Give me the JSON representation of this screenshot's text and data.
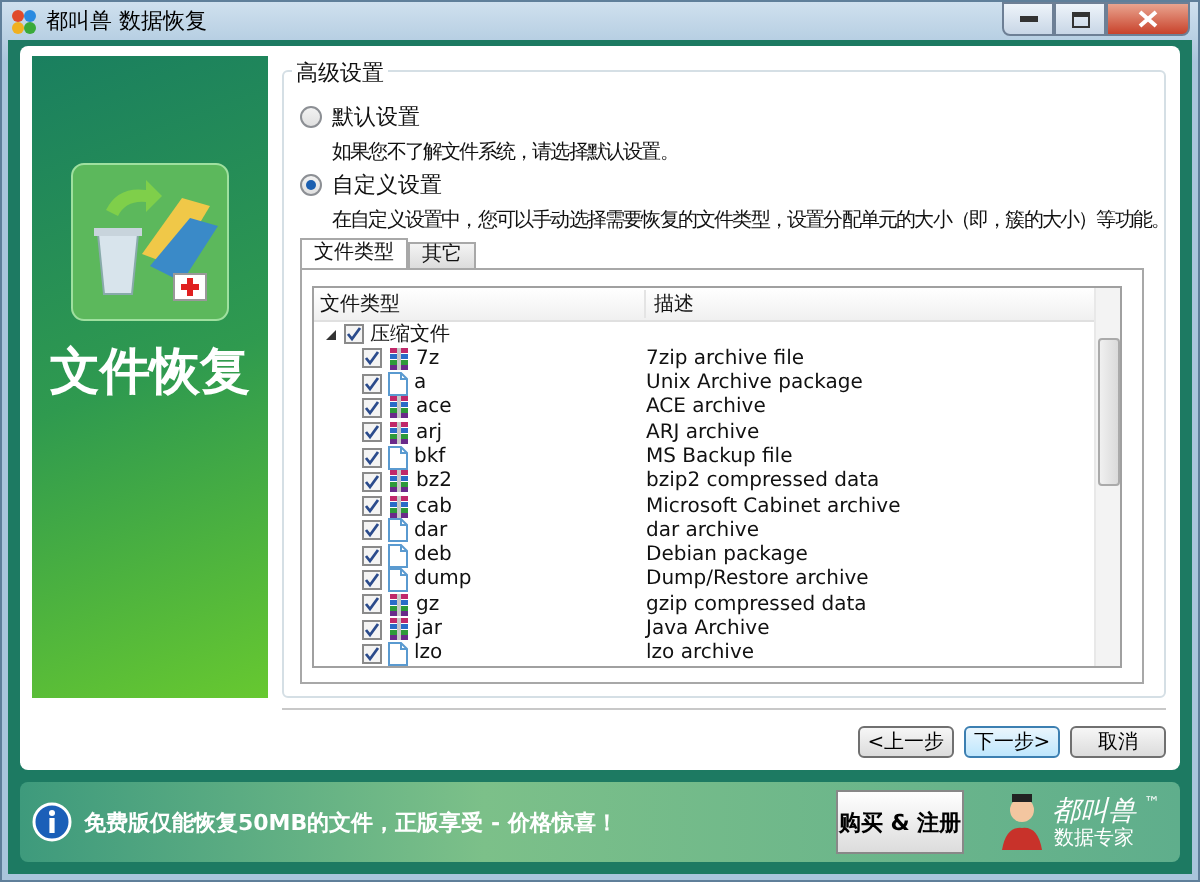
{
  "window": {
    "title": "都叫兽 数据恢复"
  },
  "side_panel": {
    "title": "文件恢复"
  },
  "settings_group": {
    "legend": "高级设置",
    "options": [
      {
        "label": "默认设置",
        "selected": false,
        "description": "如果您不了解文件系统，请选择默认设置。"
      },
      {
        "label": "自定义设置",
        "selected": true,
        "description": "在自定义设置中，您可以手动选择需要恢复的文件类型，设置分配单元的大小（即，簇的大小）等功能。"
      }
    ]
  },
  "tabs": [
    {
      "label": "文件类型",
      "selected": true
    },
    {
      "label": "其它",
      "selected": false
    }
  ],
  "table": {
    "columns": [
      "文件类型",
      "描述"
    ],
    "tree": [
      {
        "name": "压缩文件",
        "checked": true,
        "expanded": true,
        "children": [
          {
            "name": "7z",
            "kind": "archive",
            "checked": true,
            "description": "7zip archive file"
          },
          {
            "name": "a",
            "kind": "file",
            "checked": true,
            "description": "Unix Archive package"
          },
          {
            "name": "ace",
            "kind": "archive",
            "checked": true,
            "description": "ACE archive"
          },
          {
            "name": "arj",
            "kind": "archive",
            "checked": true,
            "description": "ARJ archive"
          },
          {
            "name": "bkf",
            "kind": "file",
            "checked": true,
            "description": "MS Backup file"
          },
          {
            "name": "bz2",
            "kind": "archive",
            "checked": true,
            "description": "bzip2 compressed data"
          },
          {
            "name": "cab",
            "kind": "archive",
            "checked": true,
            "description": "Microsoft Cabinet archive"
          },
          {
            "name": "dar",
            "kind": "file",
            "checked": true,
            "description": "dar archive"
          },
          {
            "name": "deb",
            "kind": "file",
            "checked": true,
            "description": "Debian package"
          },
          {
            "name": "dump",
            "kind": "file",
            "checked": true,
            "description": "Dump/Restore archive"
          },
          {
            "name": "gz",
            "kind": "archive",
            "checked": true,
            "description": "gzip compressed data"
          },
          {
            "name": "jar",
            "kind": "archive",
            "checked": true,
            "description": "Java Archive"
          },
          {
            "name": "lzo",
            "kind": "file",
            "checked": true,
            "description": "lzo archive"
          }
        ]
      }
    ]
  },
  "buttons": [
    {
      "label": "<上一步",
      "selected": false
    },
    {
      "label": "下一步>",
      "selected": true
    },
    {
      "label": "取消",
      "selected": false
    }
  ],
  "footer": {
    "message": "免费版仅能恢复50MB的文件，正版享受 - 价格惊喜！",
    "buy_button": "购买 & 注册",
    "logo_title": "都叫兽",
    "logo_subtitle": "数据专家",
    "logo_mark": "™"
  }
}
